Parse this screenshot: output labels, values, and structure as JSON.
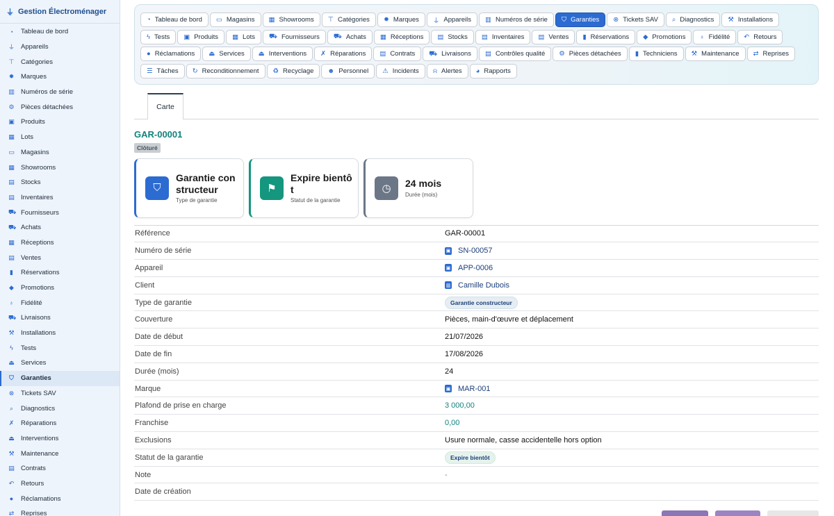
{
  "app": {
    "title": "Gestion Électroménager"
  },
  "sidebar": {
    "items": [
      {
        "label": "Tableau de bord",
        "icon": "gauge-icon",
        "glyph": "◔"
      },
      {
        "label": "Appareils",
        "icon": "plug-icon",
        "glyph": "⏚"
      },
      {
        "label": "Catégories",
        "icon": "sitemap-icon",
        "glyph": "⊤"
      },
      {
        "label": "Marques",
        "icon": "badge-icon",
        "glyph": "✹"
      },
      {
        "label": "Numéros de série",
        "icon": "barcode-icon",
        "glyph": "▥"
      },
      {
        "label": "Pièces détachées",
        "icon": "cog-icon",
        "glyph": "⚙"
      },
      {
        "label": "Produits",
        "icon": "box-icon",
        "glyph": "▣"
      },
      {
        "label": "Lots",
        "icon": "boxes-icon",
        "glyph": "▦"
      },
      {
        "label": "Magasins",
        "icon": "store-icon",
        "glyph": "▭"
      },
      {
        "label": "Showrooms",
        "icon": "grid-icon",
        "glyph": "▦"
      },
      {
        "label": "Stocks",
        "icon": "warehouse-icon",
        "glyph": "▤"
      },
      {
        "label": "Inventaires",
        "icon": "clipboard-icon",
        "glyph": "▤"
      },
      {
        "label": "Fournisseurs",
        "icon": "truck-icon",
        "glyph": "⛟"
      },
      {
        "label": "Achats",
        "icon": "cart-icon",
        "glyph": "⛟"
      },
      {
        "label": "Réceptions",
        "icon": "dolly-icon",
        "glyph": "▦"
      },
      {
        "label": "Ventes",
        "icon": "cash-icon",
        "glyph": "▤"
      },
      {
        "label": "Réservations",
        "icon": "bookmark-icon",
        "glyph": "▮"
      },
      {
        "label": "Promotions",
        "icon": "tags-icon",
        "glyph": "◆"
      },
      {
        "label": "Fidélité",
        "icon": "award-icon",
        "glyph": "♁"
      },
      {
        "label": "Livraisons",
        "icon": "shipping-icon",
        "glyph": "⛟"
      },
      {
        "label": "Installations",
        "icon": "wrench-icon",
        "glyph": "⚒"
      },
      {
        "label": "Tests",
        "icon": "bolt-icon",
        "glyph": "ϟ"
      },
      {
        "label": "Services",
        "icon": "bell-concierge-icon",
        "glyph": "⏏"
      },
      {
        "label": "Garanties",
        "icon": "shield-icon",
        "glyph": "⛉"
      },
      {
        "label": "Tickets SAV",
        "icon": "lifebuoy-icon",
        "glyph": "⊗"
      },
      {
        "label": "Diagnostics",
        "icon": "magnifier-icon",
        "glyph": "⌕"
      },
      {
        "label": "Réparations",
        "icon": "tools-icon",
        "glyph": "✗"
      },
      {
        "label": "Interventions",
        "icon": "helmet-icon",
        "glyph": "⏏"
      },
      {
        "label": "Maintenance",
        "icon": "hammer-icon",
        "glyph": "⚒"
      },
      {
        "label": "Contrats",
        "icon": "file-contract-icon",
        "glyph": "▤"
      },
      {
        "label": "Retours",
        "icon": "undo-icon",
        "glyph": "↶"
      },
      {
        "label": "Réclamations",
        "icon": "comment-icon",
        "glyph": "●"
      },
      {
        "label": "Reprises",
        "icon": "exchange-icon",
        "glyph": "⇄"
      }
    ],
    "active_index": 23
  },
  "nav": {
    "buttons": [
      {
        "label": "Tableau de bord",
        "icon": "gauge-icon",
        "glyph": "◔"
      },
      {
        "label": "Magasins",
        "icon": "store-icon",
        "glyph": "▭"
      },
      {
        "label": "Showrooms",
        "icon": "grid-icon",
        "glyph": "▦"
      },
      {
        "label": "Catégories",
        "icon": "sitemap-icon",
        "glyph": "⊤"
      },
      {
        "label": "Marques",
        "icon": "badge-icon",
        "glyph": "✹"
      },
      {
        "label": "Appareils",
        "icon": "plug-icon",
        "glyph": "⏚"
      },
      {
        "label": "Numéros de série",
        "icon": "barcode-icon",
        "glyph": "▥"
      },
      {
        "label": "Garanties",
        "icon": "shield-icon",
        "glyph": "⛉"
      },
      {
        "label": "Tickets SAV",
        "icon": "lifebuoy-icon",
        "glyph": "⊗"
      },
      {
        "label": "Diagnostics",
        "icon": "magnifier-icon",
        "glyph": "⌕"
      },
      {
        "label": "Installations",
        "icon": "wrench-icon",
        "glyph": "⚒"
      },
      {
        "label": "Tests",
        "icon": "bolt-icon",
        "glyph": "ϟ"
      },
      {
        "label": "Produits",
        "icon": "box-icon",
        "glyph": "▣"
      },
      {
        "label": "Lots",
        "icon": "boxes-icon",
        "glyph": "▦"
      },
      {
        "label": "Fournisseurs",
        "icon": "truck-icon",
        "glyph": "⛟"
      },
      {
        "label": "Achats",
        "icon": "cart-icon",
        "glyph": "⛟"
      },
      {
        "label": "Réceptions",
        "icon": "dolly-icon",
        "glyph": "▦"
      },
      {
        "label": "Stocks",
        "icon": "warehouse-icon",
        "glyph": "▤"
      },
      {
        "label": "Inventaires",
        "icon": "clipboard-icon",
        "glyph": "▤"
      },
      {
        "label": "Ventes",
        "icon": "cash-icon",
        "glyph": "▤"
      },
      {
        "label": "Réservations",
        "icon": "bookmark-icon",
        "glyph": "▮"
      },
      {
        "label": "Promotions",
        "icon": "tags-icon",
        "glyph": "◆"
      },
      {
        "label": "Fidélité",
        "icon": "award-icon",
        "glyph": "♁"
      },
      {
        "label": "Retours",
        "icon": "undo-icon",
        "glyph": "↶"
      },
      {
        "label": "Réclamations",
        "icon": "comment-icon",
        "glyph": "●"
      },
      {
        "label": "Services",
        "icon": "bell-concierge-icon",
        "glyph": "⏏"
      },
      {
        "label": "Interventions",
        "icon": "helmet-icon",
        "glyph": "⏏"
      },
      {
        "label": "Réparations",
        "icon": "tools-icon",
        "glyph": "✗"
      },
      {
        "label": "Contrats",
        "icon": "file-contract-icon",
        "glyph": "▤"
      },
      {
        "label": "Livraisons",
        "icon": "shipping-icon",
        "glyph": "⛟"
      },
      {
        "label": "Contrôles qualité",
        "icon": "clipboard-check-icon",
        "glyph": "▤"
      },
      {
        "label": "Pièces détachées",
        "icon": "cog-icon",
        "glyph": "⚙"
      },
      {
        "label": "Techniciens",
        "icon": "id-badge-icon",
        "glyph": "▮"
      },
      {
        "label": "Maintenance",
        "icon": "hammer-icon",
        "glyph": "⚒"
      },
      {
        "label": "Reprises",
        "icon": "exchange-icon",
        "glyph": "⇄"
      },
      {
        "label": "Tâches",
        "icon": "tasks-icon",
        "glyph": "☰"
      },
      {
        "label": "Reconditionnement",
        "icon": "redo-icon",
        "glyph": "↻"
      },
      {
        "label": "Recyclage",
        "icon": "recycle-icon",
        "glyph": "♻"
      },
      {
        "label": "Personnel",
        "icon": "users-icon",
        "glyph": "☻"
      },
      {
        "label": "Incidents",
        "icon": "warning-icon",
        "glyph": "⚠"
      },
      {
        "label": "Alertes",
        "icon": "bell-icon",
        "glyph": "⍾"
      },
      {
        "label": "Rapports",
        "icon": "chart-pie-icon",
        "glyph": "◕"
      }
    ],
    "active_index": 7
  },
  "tabs": [
    {
      "label": "Carte"
    }
  ],
  "record": {
    "title": "GAR-00001",
    "status_badge": "Clôturé",
    "cards": [
      {
        "value": "Garantie constructeur",
        "caption": "Type de garantie",
        "icon": "shield-icon",
        "glyph": "⛉",
        "color": "#2c6bd1"
      },
      {
        "value": "Expire bientôt",
        "caption": "Statut de la garantie",
        "icon": "flag-icon",
        "glyph": "⚑",
        "color": "#14967f"
      },
      {
        "value": "24 mois",
        "caption": "Durée (mois)",
        "icon": "clock-icon",
        "glyph": "◷",
        "color": "#6b7787"
      }
    ],
    "fields": [
      {
        "label": "Référence",
        "value": "GAR-00001",
        "kind": "text"
      },
      {
        "label": "Numéro de série",
        "value": "SN-00057",
        "kind": "link",
        "icon": "record-icon",
        "glyph": "▣"
      },
      {
        "label": "Appareil",
        "value": "APP-0006",
        "kind": "link",
        "icon": "record-icon",
        "glyph": "▣"
      },
      {
        "label": "Client",
        "value": "Camille Dubois",
        "kind": "link",
        "icon": "building-icon",
        "glyph": "▥"
      },
      {
        "label": "Type de garantie",
        "value": "Garantie constructeur",
        "kind": "pill"
      },
      {
        "label": "Couverture",
        "value": "Pièces, main-d'œuvre et déplacement",
        "kind": "text"
      },
      {
        "label": "Date de début",
        "value": "21/07/2026",
        "kind": "text"
      },
      {
        "label": "Date de fin",
        "value": "17/08/2026",
        "kind": "text"
      },
      {
        "label": "Durée (mois)",
        "value": "24",
        "kind": "text"
      },
      {
        "label": "Marque",
        "value": "MAR-001",
        "kind": "link",
        "icon": "record-icon",
        "glyph": "▣"
      },
      {
        "label": "Plafond de prise en charge",
        "value": "3 000,00",
        "kind": "num"
      },
      {
        "label": "Franchise",
        "value": "0,00",
        "kind": "num"
      },
      {
        "label": "Exclusions",
        "value": "Usure normale, casse accidentelle hors option",
        "kind": "text"
      },
      {
        "label": "Statut de la garantie",
        "value": "Expire bientôt",
        "kind": "pill-green"
      },
      {
        "label": "Note",
        "value": "-",
        "kind": "muted"
      },
      {
        "label": "Date de création",
        "value": "",
        "kind": "text"
      }
    ]
  }
}
